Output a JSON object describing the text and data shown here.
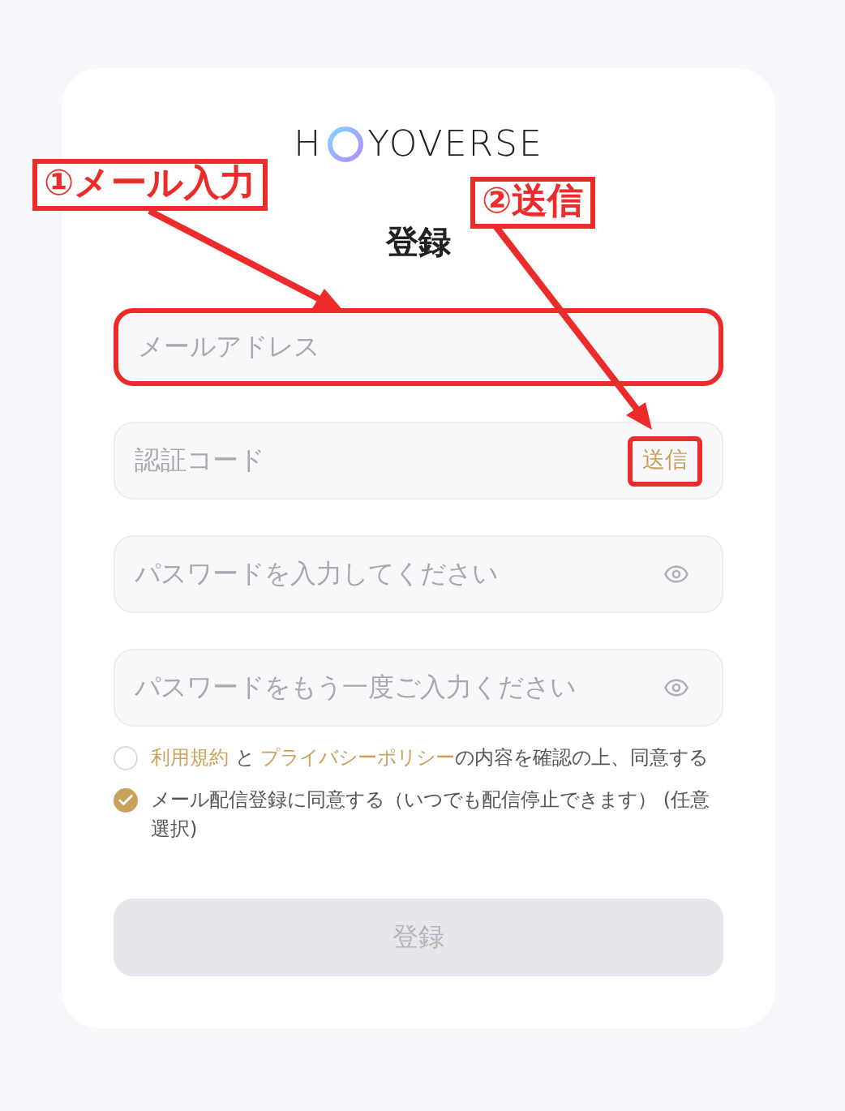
{
  "logo": {
    "left": "H",
    "right": "YOVERSE"
  },
  "title": "登録",
  "fields": [
    {
      "placeholder": "メールアドレス",
      "kind": "text",
      "highlighted": true
    },
    {
      "placeholder": "認証コード",
      "kind": "code",
      "action": "送信",
      "highlighted": true
    },
    {
      "placeholder": "パスワードを入力してください",
      "kind": "password",
      "highlighted": false
    },
    {
      "placeholder": "パスワードをもう一度ご入力ください",
      "kind": "password",
      "highlighted": false
    }
  ],
  "agreements": [
    {
      "checked": false,
      "parts": [
        {
          "kind": "link",
          "text": "利用規約"
        },
        {
          "kind": "text",
          "text": " と "
        },
        {
          "kind": "link",
          "text": "プライバシーポリシー"
        },
        {
          "kind": "text",
          "text": "の内容を確認の上、同意する"
        }
      ]
    },
    {
      "checked": true,
      "parts": [
        {
          "kind": "text",
          "text": "メール配信登録に同意する（いつでも配信停止できます） (任意選択)"
        }
      ]
    }
  ],
  "submit": {
    "label": "登録",
    "disabled": true
  },
  "annotations": [
    {
      "label": "①メール入力"
    },
    {
      "label": "②送信"
    }
  ]
}
